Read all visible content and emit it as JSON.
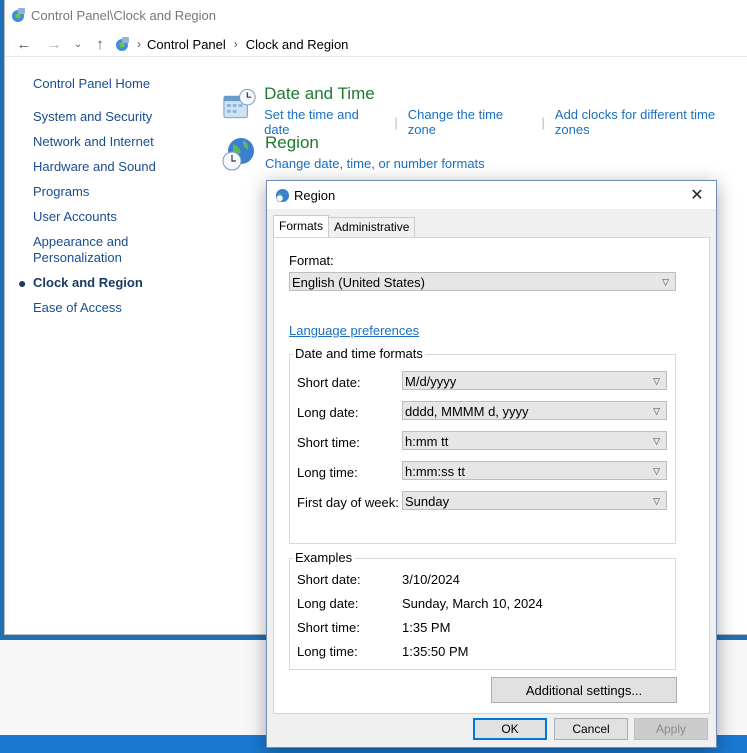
{
  "window": {
    "title": "Control Panel\\Clock and Region",
    "icon": "control-panel-icon"
  },
  "address": {
    "crumbs": [
      "Control Panel",
      "Clock and Region"
    ]
  },
  "sidebar": {
    "home": "Control Panel Home",
    "items": [
      "System and Security",
      "Network and Internet",
      "Hardware and Sound",
      "Programs",
      "User Accounts",
      "Appearance and Personalization",
      "Clock and Region",
      "Ease of Access"
    ],
    "active": "Clock and Region"
  },
  "categories": [
    {
      "title": "Date and Time",
      "icon": "date-time-icon",
      "links": [
        "Set the time and date",
        "Change the time zone",
        "Add clocks for different time zones"
      ]
    },
    {
      "title": "Region",
      "icon": "globe-clock-icon",
      "links": [
        "Change date, time, or number formats"
      ]
    }
  ],
  "dialog": {
    "title": "Region",
    "close": "✕",
    "tabs": [
      "Formats",
      "Administrative"
    ],
    "active_tab": "Formats",
    "format_label": "Format:",
    "format_value": "English (United States)",
    "language_link": "Language preferences",
    "dt_group_title": "Date and time formats",
    "fields": [
      {
        "label": "Short date:",
        "value": "M/d/yyyy"
      },
      {
        "label": "Long date:",
        "value": "dddd, MMMM d, yyyy"
      },
      {
        "label": "Short time:",
        "value": "h:mm tt"
      },
      {
        "label": "Long time:",
        "value": "h:mm:ss tt"
      },
      {
        "label": "First day of week:",
        "value": "Sunday"
      }
    ],
    "examples_title": "Examples",
    "examples": [
      {
        "label": "Short date:",
        "value": "3/10/2024"
      },
      {
        "label": "Long date:",
        "value": "Sunday, March 10, 2024"
      },
      {
        "label": "Short time:",
        "value": "1:35 PM"
      },
      {
        "label": "Long time:",
        "value": "1:35:50 PM"
      }
    ],
    "additional_settings": "Additional settings...",
    "ok": "OK",
    "cancel": "Cancel",
    "apply": "Apply"
  }
}
